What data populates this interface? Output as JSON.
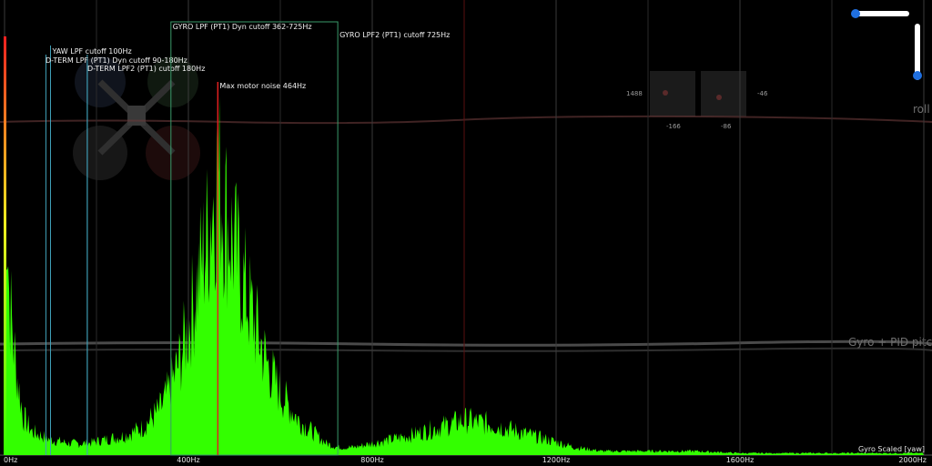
{
  "chart_data": {
    "type": "area",
    "title": "",
    "series": [
      {
        "name": "Gyro Scaled [yaw]",
        "x": [
          0,
          10,
          20,
          30,
          40,
          60,
          80,
          100,
          140,
          180,
          220,
          260,
          300,
          340,
          360,
          380,
          400,
          420,
          440,
          450,
          464,
          475,
          490,
          510,
          530,
          550,
          570,
          600,
          640,
          680,
          700,
          725,
          760,
          800,
          840,
          880,
          940,
          1000,
          1060,
          1120,
          1180,
          1240,
          1300,
          1400,
          1500,
          1600,
          1800,
          2000
        ],
        "y": [
          88,
          42,
          28,
          18,
          10,
          6,
          5,
          4,
          3,
          3,
          4,
          5,
          7,
          12,
          17,
          24,
          33,
          45,
          56,
          64,
          72,
          66,
          58,
          49,
          40,
          32,
          24,
          16,
          9,
          5,
          3,
          2,
          2,
          3,
          4,
          5,
          7,
          9,
          8,
          6,
          4,
          2,
          1,
          1,
          1,
          0.5,
          0.5,
          0.5
        ]
      }
    ],
    "xlim": [
      0,
      2000
    ],
    "ylim": [
      0,
      100
    ],
    "x_ticks": [
      "0Hz",
      "400Hz",
      "800Hz",
      "1200Hz",
      "1600Hz",
      "2000Hz"
    ],
    "x_tick_values": [
      0,
      400,
      800,
      1200,
      1600,
      2000
    ],
    "grid": true,
    "annotations": {
      "yaw_lpf": {
        "label": "YAW LPF cutoff 100Hz",
        "freq": 100,
        "color": "#3fa0b8"
      },
      "dterm_lpf": {
        "label": "D-TERM LPF (PT1) Dyn cutoff 90-180Hz",
        "freq": 90,
        "freq2": 180,
        "color": "#3fa0b8"
      },
      "dterm_lpf2": {
        "label": "D-TERM LPF2 (PT1) cutoff 180Hz",
        "freq": 180,
        "color": "#3fa0b8"
      },
      "gyro_lpf": {
        "label": "GYRO LPF (PT1) Dyn cutoff 362-725Hz",
        "freq": 362,
        "freq2": 725,
        "color": "#3a9a6a"
      },
      "gyro_lpf2": {
        "label": "GYRO LPF2 (PT1) cutoff 725Hz",
        "freq": 725,
        "color": "#3a9a6a"
      },
      "max_motor": {
        "label": "Max motor noise 464Hz",
        "freq": 464,
        "color": "#e02020"
      }
    }
  },
  "overlay": {
    "trace_roll": "roll",
    "trace_pitch": "Gyro + PID pitch",
    "stick_values": [
      "1488",
      "-46",
      "-166",
      "-86"
    ],
    "stick_label": "Gyro",
    "colors": {
      "bg": "#000000",
      "spectrum": "#33ff00",
      "slider": "#1f6fe0"
    }
  }
}
